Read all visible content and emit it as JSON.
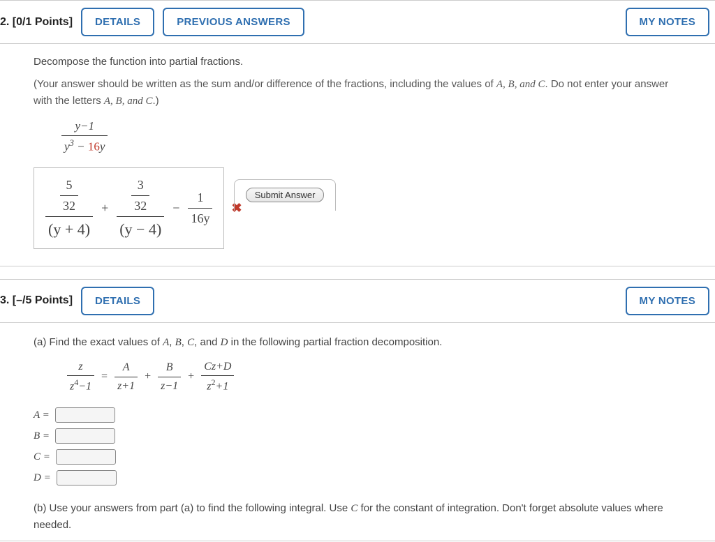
{
  "q2": {
    "number": "2.",
    "points": "[0/1 Points]",
    "details_btn": "DETAILS",
    "prev_answers_btn": "PREVIOUS ANSWERS",
    "my_notes_btn": "MY NOTES",
    "instruction1": "Decompose the function into partial fractions.",
    "instruction2_a": "(Your answer should be written as the sum and/or difference of the fractions, including the values of ",
    "instruction2_b": ". Do not enter your answer with the letters ",
    "instruction2_c": ".)",
    "abc_list1": "A, B, and C",
    "abc_list2": "A, B, and C",
    "expr_num": "y−1",
    "expr_den_a": "y",
    "expr_den_b": " − ",
    "expr_den_c": "16",
    "expr_den_d": "y",
    "ans_t1_num": "5",
    "ans_t1_mid": "32",
    "ans_t1_den": "(y + 4)",
    "ans_plus": "+",
    "ans_t2_num": "3",
    "ans_t2_mid": "32",
    "ans_t2_den": "(y − 4)",
    "ans_minus": "−",
    "ans_t3_num": "1",
    "ans_t3_den": "16y",
    "wrong_icon_label": "✖",
    "submit_label": "Submit Answer"
  },
  "q3": {
    "number": "3.",
    "points": "[–/5 Points]",
    "details_btn": "DETAILS",
    "my_notes_btn": "MY NOTES",
    "part_a": "(a) Find the exact values of A, B, C, and D in the following partial fraction decomposition.",
    "lhs_num": "z",
    "lhs_den_a": "z",
    "lhs_den_b": "−1",
    "eq": "=",
    "t1_num": "A",
    "t1_den": "z+1",
    "plus1": "+",
    "t2_num": "B",
    "t2_den": "z−1",
    "plus2": "+",
    "t3_num": "Cz+D",
    "t3_den_a": "z",
    "t3_den_b": "+1",
    "label_A": "A =",
    "label_B": "B =",
    "label_C": "C =",
    "label_D": "D =",
    "part_b": "(b) Use your answers from part (a) to find the following integral. Use C for the constant of integration. Don't forget absolute values where needed."
  }
}
